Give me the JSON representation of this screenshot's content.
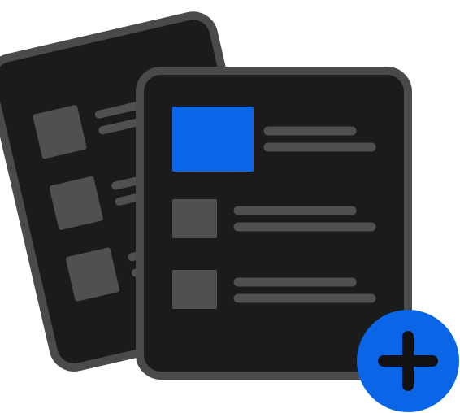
{
  "icon": {
    "name": "add-list-documents-icon",
    "back_document": {
      "rows": 3
    },
    "front_document": {
      "rows": 3,
      "highlighted_row": 1
    },
    "add_badge": {
      "icon": "plus-icon"
    }
  },
  "colors": {
    "card_fill": "#1b1b1b",
    "card_border": "#4a4a4a",
    "placeholder": "#505050",
    "accent": "#0a66e6",
    "plus": "#111111"
  }
}
